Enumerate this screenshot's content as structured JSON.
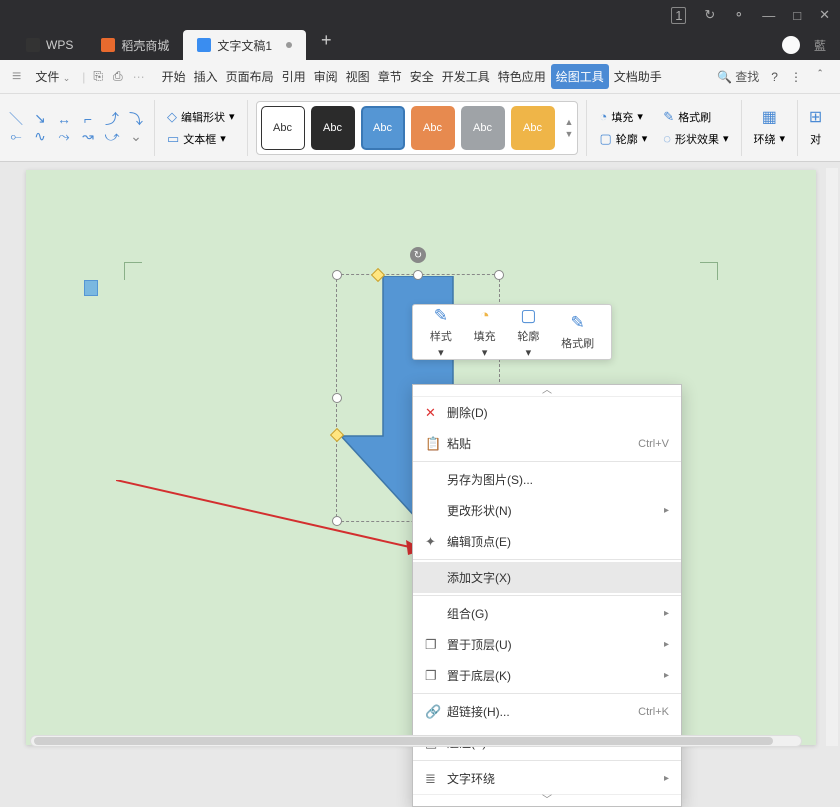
{
  "titlebar": {
    "controls": [
      "1",
      "↻",
      "⚬",
      "—",
      "□",
      "✕"
    ],
    "user": "藍"
  },
  "tabs": {
    "wps": "WPS",
    "docer": "稻壳商城",
    "doc": "文字文稿1",
    "plus": "+"
  },
  "ribbon": {
    "file": "文件",
    "dd": "⌄",
    "tabs": [
      "开始",
      "插入",
      "页面布局",
      "引用",
      "审阅",
      "视图",
      "章节",
      "安全",
      "开发工具",
      "特色应用",
      "绘图工具",
      "文档助手"
    ],
    "active_idx": 10,
    "search": "查找"
  },
  "toolbar": {
    "edit_shape": "编辑形状",
    "textbox": "文本框",
    "abc": "Abc",
    "fill": "填充",
    "fmt_brush": "格式刷",
    "outline": "轮廓",
    "effect": "形状效果",
    "wrap": "环绕",
    "align": "对"
  },
  "mini": {
    "style": "样式",
    "fill": "填充",
    "outline": "轮廓",
    "brush": "格式刷"
  },
  "ctx": {
    "delete": "删除(D)",
    "paste": "粘贴",
    "paste_sc": "Ctrl+V",
    "save_img": "另存为图片(S)...",
    "change_shape": "更改形状(N)",
    "edit_vertex": "编辑顶点(E)",
    "add_text": "添加文字(X)",
    "group": "组合(G)",
    "bring_front": "置于顶层(U)",
    "send_back": "置于底层(K)",
    "hyperlink": "超链接(H)...",
    "hyperlink_sc": "Ctrl+K",
    "note": "题注(Z)...",
    "wrap": "文字环绕"
  }
}
